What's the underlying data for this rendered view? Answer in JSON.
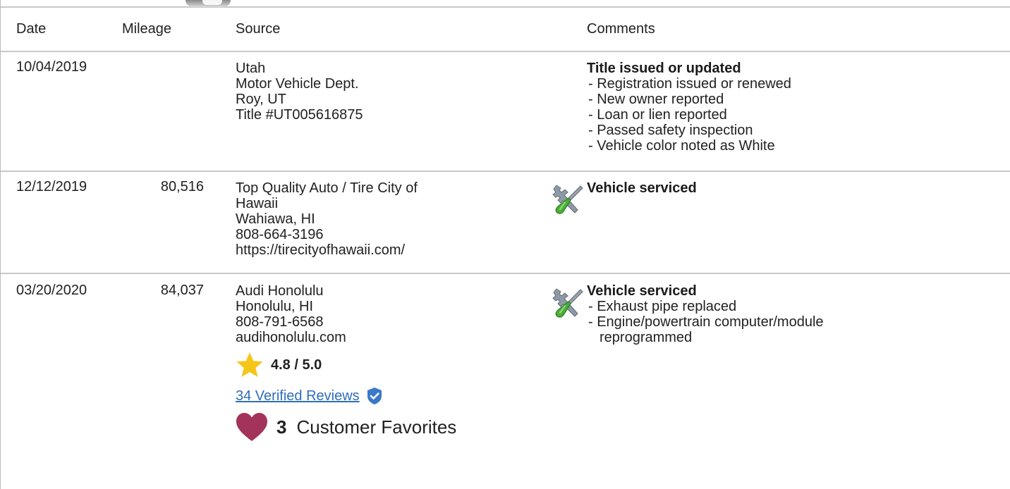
{
  "table": {
    "headers": {
      "date": "Date",
      "mileage": "Mileage",
      "source": "Source",
      "comments": "Comments"
    },
    "rows": [
      {
        "date": "10/04/2019",
        "mileage": "",
        "source": [
          "Utah",
          "Motor Vehicle Dept.",
          "Roy, UT",
          "Title #UT005616875"
        ],
        "icon": "",
        "comment_title": "Title issued or updated",
        "comment_items": [
          "- Registration issued or renewed",
          "- New owner reported",
          "- Loan or lien reported",
          "- Passed safety inspection",
          "- Vehicle color noted as White"
        ]
      },
      {
        "date": "12/12/2019",
        "mileage": "80,516",
        "source": [
          "Top Quality Auto / Tire City of",
          "Hawaii",
          "Wahiawa, HI",
          "808-664-3196",
          "https://tirecityofhawaii.com/"
        ],
        "icon": "wrench-screwdriver-icon",
        "comment_title": "Vehicle serviced",
        "comment_items": []
      },
      {
        "date": "03/20/2020",
        "mileage": "84,037",
        "source": [
          "Audi Honolulu",
          "Honolulu, HI",
          "808-791-6568",
          "audihonolulu.com"
        ],
        "icon": "wrench-screwdriver-icon",
        "comment_title": "Vehicle serviced",
        "comment_items": [
          "- Exhaust pipe replaced",
          "- Engine/powertrain computer/module",
          "reprogrammed"
        ],
        "rating": "4.8 / 5.0",
        "reviews_link": "34 Verified Reviews",
        "favorites_count": "3",
        "favorites_label": "Customer Favorites"
      }
    ]
  },
  "colors": {
    "link": "#2f6db8",
    "star": "#f5c518",
    "heart": "#a3335a",
    "verified_badge": "#3a78c9",
    "border": "#c8c8c8"
  }
}
